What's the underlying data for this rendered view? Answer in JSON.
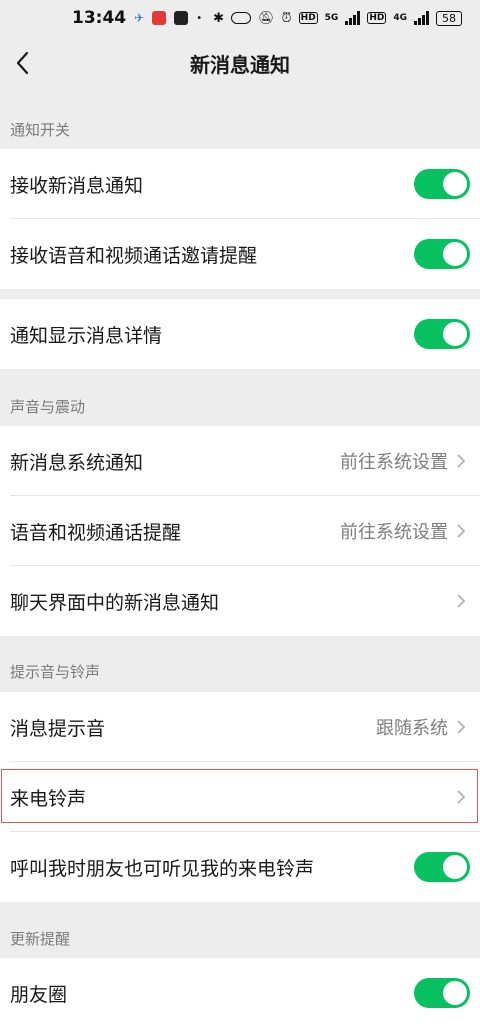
{
  "status_bar": {
    "time": "13:44",
    "network_5g": "5G",
    "network_4g": "4G",
    "hd": "HD",
    "battery": "58"
  },
  "nav": {
    "title": "新消息通知"
  },
  "sections": [
    {
      "header": "通知开关"
    },
    {
      "header": "声音与震动"
    },
    {
      "header": "提示音与铃声"
    },
    {
      "header": "更新提醒"
    }
  ],
  "rows": {
    "receive_new": {
      "label": "接收新消息通知",
      "toggle": "on"
    },
    "receive_call": {
      "label": "接收语音和视频通话邀请提醒",
      "toggle": "on"
    },
    "show_detail": {
      "label": "通知显示消息详情",
      "toggle": "on"
    },
    "system_notify": {
      "label": "新消息系统通知",
      "value": "前往系统设置"
    },
    "call_remind": {
      "label": "语音和视频通话提醒",
      "value": "前往系统设置"
    },
    "chat_notify": {
      "label": "聊天界面中的新消息通知"
    },
    "message_tone": {
      "label": "消息提示音",
      "value": "跟随系统"
    },
    "ringtone": {
      "label": "来电铃声"
    },
    "friends_hear": {
      "label": "呼叫我时朋友也可听见我的来电铃声",
      "toggle": "on"
    },
    "moments": {
      "label": "朋友圈",
      "toggle": "on"
    }
  },
  "colors": {
    "toggle_on": "#07c160",
    "highlight": "#e05a5a"
  }
}
